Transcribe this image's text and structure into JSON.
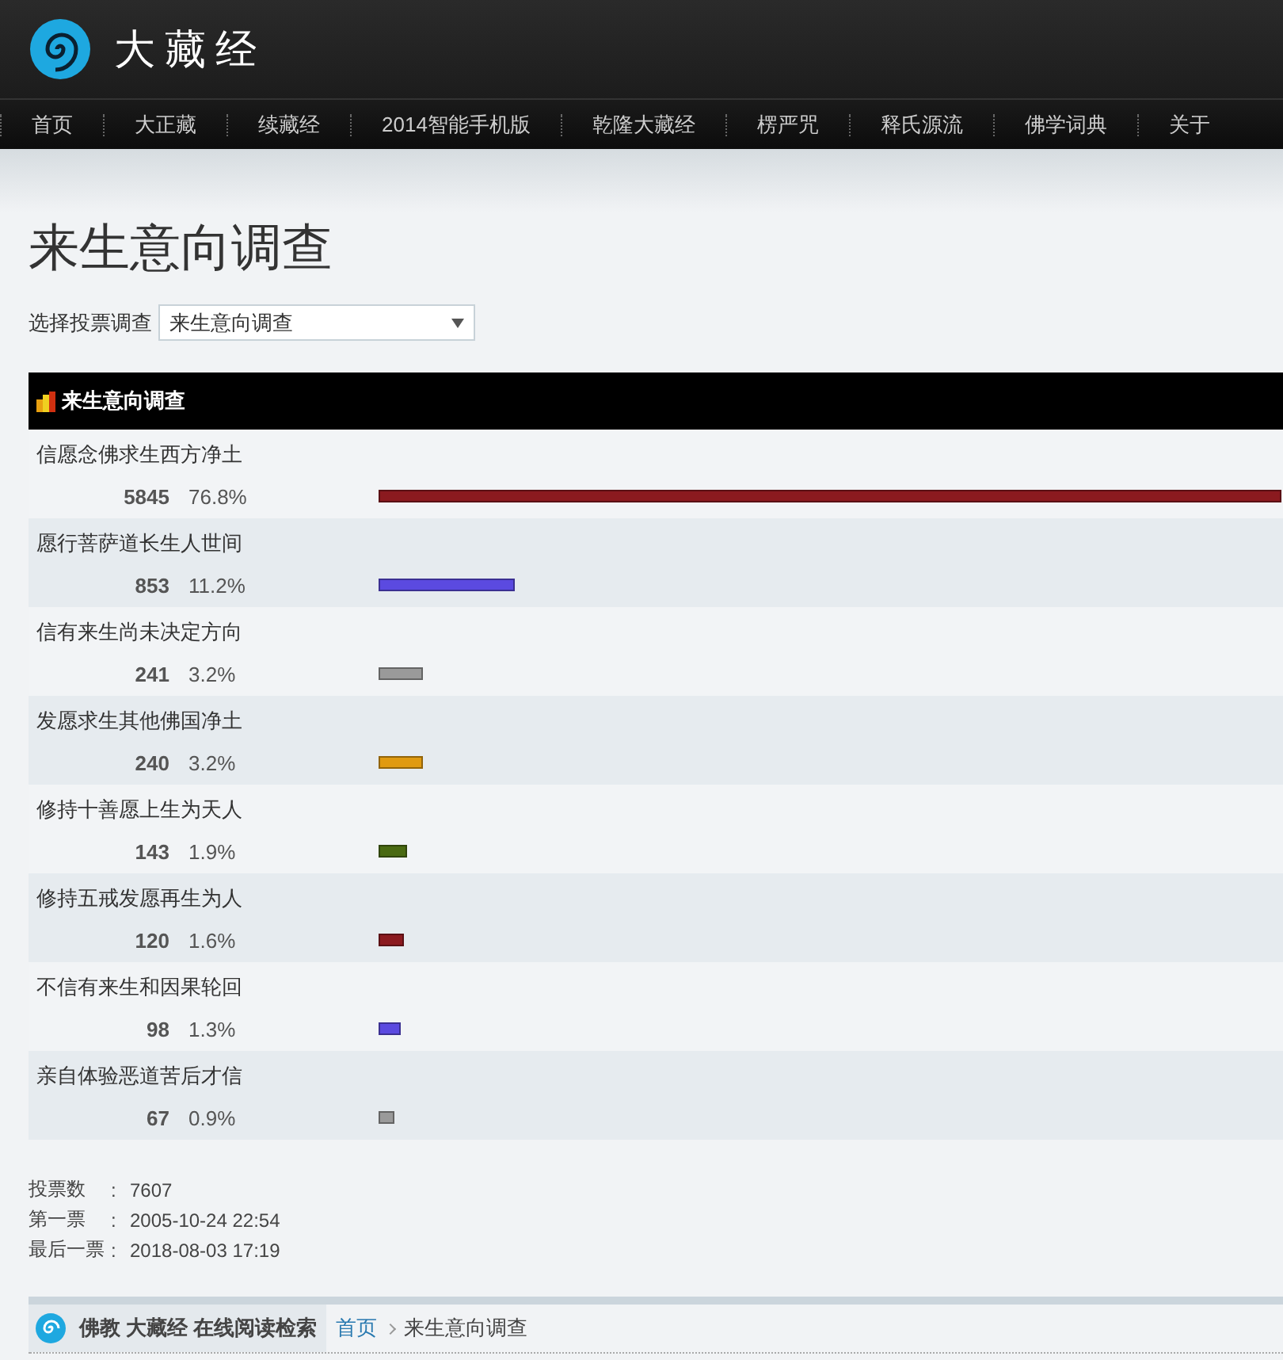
{
  "site": {
    "title": "大藏经"
  },
  "nav": [
    "首页",
    "大正藏",
    "续藏经",
    "2014智能手机版",
    "乾隆大藏经",
    "楞严咒",
    "释氏源流",
    "佛学词典",
    "关于"
  ],
  "page_title": "来生意向调查",
  "selector": {
    "label": "选择投票调查",
    "value": "来生意向调查"
  },
  "poll": {
    "title": "来生意向调查",
    "options": [
      {
        "label": "信愿念佛求生西方净土",
        "count": "5845",
        "percent": "76.8%",
        "level": 1,
        "color": "#8b1a1f"
      },
      {
        "label": "愿行菩萨道长生人世间",
        "count": "853",
        "percent": "11.2%",
        "level": 0.151,
        "color": "#5b4ae0"
      },
      {
        "label": "信有来生尚未决定方向",
        "count": "241",
        "percent": "3.2%",
        "level": 0.049,
        "color": "#9a9a9a"
      },
      {
        "label": "发愿求生其他佛国净土",
        "count": "240",
        "percent": "3.2%",
        "level": 0.049,
        "color": "#e09a10"
      },
      {
        "label": "修持十善愿上生为天人",
        "count": "143",
        "percent": "1.9%",
        "level": 0.032,
        "color": "#4a6a12"
      },
      {
        "label": "修持五戒发愿再生为人",
        "count": "120",
        "percent": "1.6%",
        "level": 0.028,
        "color": "#8b1a1f"
      },
      {
        "label": "不信有来生和因果轮回",
        "count": "98",
        "percent": "1.3%",
        "level": 0.025,
        "color": "#5b4ae0"
      },
      {
        "label": "亲自体验恶道苦后才信",
        "count": "67",
        "percent": "0.9%",
        "level": 0.018,
        "color": "#9a9a9a"
      }
    ]
  },
  "stats": [
    {
      "label": "投票数",
      "sep": ":",
      "value": "7607"
    },
    {
      "label": "第一票",
      "sep": ":",
      "value": "2005-10-24 22:54"
    },
    {
      "label": "最后一票",
      "sep": ":",
      "value": "2018-08-03 17:19"
    }
  ],
  "footer": {
    "brand": "佛教 大藏经 在线阅读检索",
    "breadcrumb": [
      {
        "label": "首页",
        "kind": "link"
      },
      {
        "label": "来生意向调查",
        "kind": "current"
      }
    ]
  }
}
